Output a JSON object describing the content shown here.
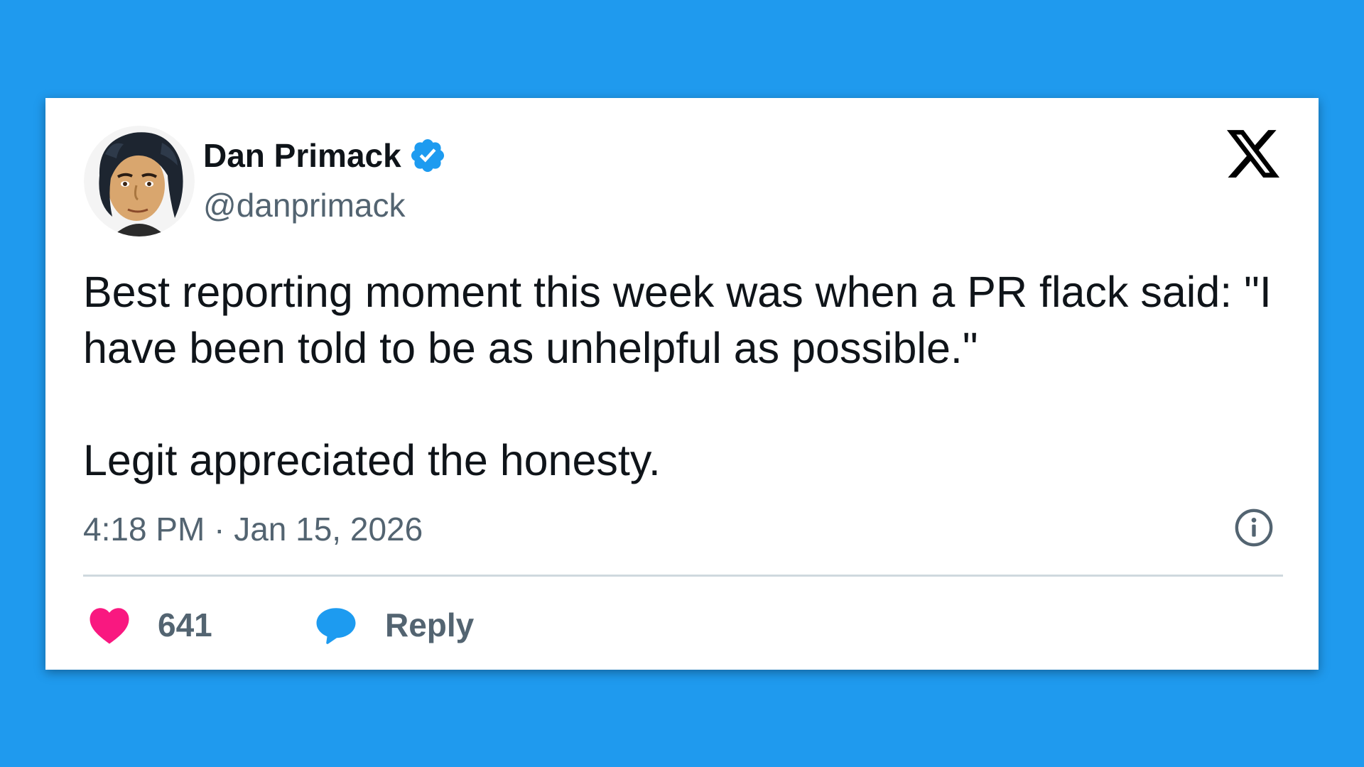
{
  "page": {
    "background_color": "#1f9aee"
  },
  "tweet": {
    "author": {
      "name": "Dan Primack",
      "handle": "@danprimack",
      "verified": true,
      "verified_color": "#1d9bf0",
      "avatar_icon": "avatar-illustration"
    },
    "platform_logo": "x-logo-icon",
    "text_paragraphs": [
      "Best reporting moment this week was when a PR flack said: \"I have been told to be as unhelpful as possible.\"",
      "Legit appreciated the honesty."
    ],
    "timestamp": "4:18 PM · Jan 15, 2026",
    "info_icon": "info-icon",
    "actions": {
      "like_count": "641",
      "like_color": "#f91880",
      "reply_label": "Reply",
      "reply_color": "#1d9bf0"
    }
  },
  "colors": {
    "text_primary": "#0f1419",
    "text_secondary": "#536471",
    "divider": "#cfd9de"
  }
}
